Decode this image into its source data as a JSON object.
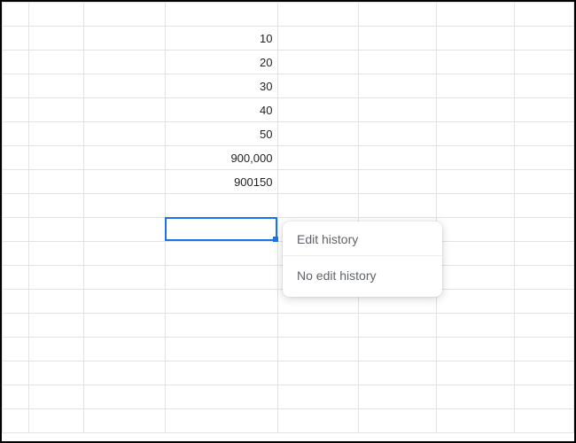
{
  "cells": {
    "r2c3": "10",
    "r3c3": "20",
    "r4c3": "30",
    "r5c3": "40",
    "r6c3": "50",
    "r7c3": "900,000",
    "r8c3": "900150"
  },
  "popover": {
    "title": "Edit history",
    "body": "No edit history"
  }
}
